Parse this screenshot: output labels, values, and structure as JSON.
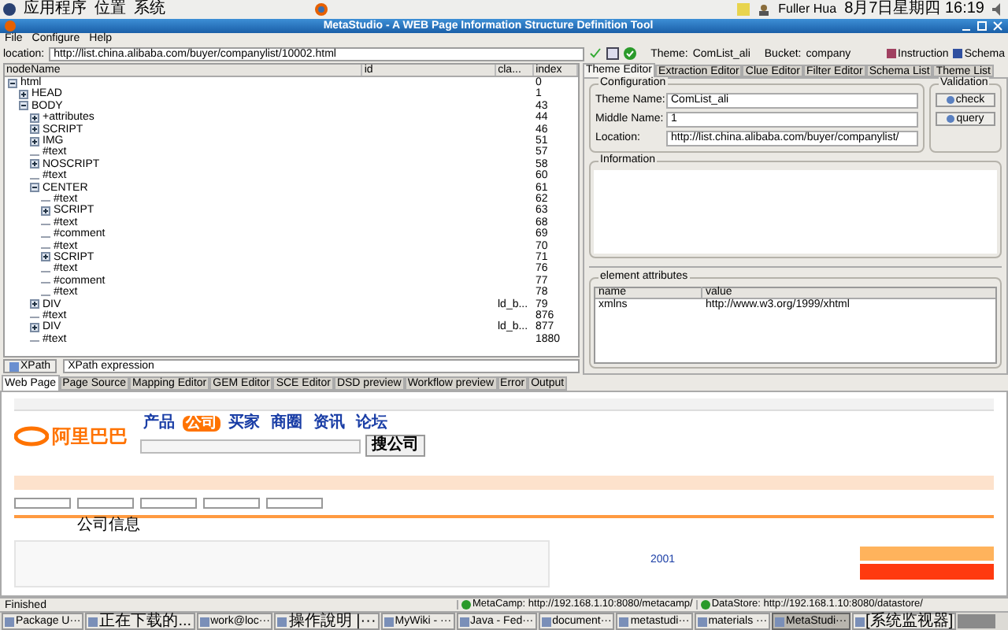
{
  "top_panel": {
    "menus": [
      "应用程序",
      "位置",
      "系统"
    ],
    "user": "Fuller Hua",
    "clock": "8月7日星期四 16:19"
  },
  "window": {
    "title": "MetaStudio - A WEB Page Information Structure Definition Tool"
  },
  "menu_bar": [
    "File",
    "Configure",
    "Help"
  ],
  "toolbar": {
    "location_label": "location:",
    "location": "http://list.china.alibaba.com/buyer/companylist/10002.html",
    "theme_label": "Theme:",
    "theme": "ComList_ali",
    "bucket_label": "Bucket:",
    "bucket": "company",
    "buttons": [
      "Instruction",
      "Schema"
    ]
  },
  "tree": {
    "columns": [
      "nodeName",
      "id",
      "cla...",
      "index"
    ],
    "nodes": [
      {
        "name": "html",
        "index": "0",
        "expanded": true,
        "children": [
          {
            "name": "HEAD",
            "index": "1",
            "expanded": false
          },
          {
            "name": "BODY",
            "index": "43",
            "expanded": true,
            "children": [
              {
                "name": "+attributes",
                "index": "44",
                "expanded": false
              },
              {
                "name": "SCRIPT",
                "index": "46",
                "expanded": false
              },
              {
                "name": "IMG",
                "index": "51",
                "expanded": false
              },
              {
                "name": "#text",
                "index": "57"
              },
              {
                "name": "NOSCRIPT",
                "index": "58",
                "expanded": false
              },
              {
                "name": "#text",
                "index": "60"
              },
              {
                "name": "CENTER",
                "index": "61",
                "expanded": true,
                "children": [
                  {
                    "name": "#text",
                    "index": "62"
                  },
                  {
                    "name": "SCRIPT",
                    "index": "63",
                    "expanded": false
                  },
                  {
                    "name": "#text",
                    "index": "68"
                  },
                  {
                    "name": "#comment",
                    "index": "69"
                  },
                  {
                    "name": "#text",
                    "index": "70"
                  },
                  {
                    "name": "SCRIPT",
                    "index": "71",
                    "expanded": false
                  },
                  {
                    "name": "#text",
                    "index": "76"
                  },
                  {
                    "name": "#comment",
                    "index": "77"
                  },
                  {
                    "name": "#text",
                    "index": "78"
                  }
                ]
              },
              {
                "name": "DIV",
                "cls": "ld_b...",
                "index": "79",
                "expanded": false
              },
              {
                "name": "#text",
                "index": "876"
              },
              {
                "name": "DIV",
                "cls": "ld_b...",
                "index": "877",
                "expanded": false
              },
              {
                "name": "#text",
                "index": "1880"
              }
            ]
          }
        ]
      }
    ]
  },
  "xpath": {
    "button": "XPath",
    "value": "XPath expression"
  },
  "editor_tabs": [
    {
      "label": "Theme Editor",
      "selected": true
    },
    {
      "label": "Extraction Editor",
      "selected": false
    },
    {
      "label": "Clue Editor",
      "selected": false
    },
    {
      "label": "Filter Editor",
      "selected": false
    },
    {
      "label": "Schema List",
      "selected": false
    },
    {
      "label": "Theme List",
      "selected": false
    }
  ],
  "configuration": {
    "title": "Configuration",
    "fields": [
      {
        "label": "Theme Name:",
        "value": "ComList_ali"
      },
      {
        "label": "Middle Name:",
        "value": "1"
      },
      {
        "label": "Location:",
        "value": "http://list.china.alibaba.com/buyer/companylist/"
      }
    ]
  },
  "validation": {
    "title": "Validation",
    "buttons": [
      "check",
      "query"
    ]
  },
  "information": {
    "title": "Information"
  },
  "element_attributes": {
    "title": "element attributes",
    "columns": [
      "name",
      "value"
    ],
    "rows": [
      [
        "xmlns",
        "http://www.w3.org/1999/xhtml"
      ]
    ]
  },
  "bottom_tabs": [
    {
      "label": "Web Page",
      "selected": true
    },
    {
      "label": "Page Source",
      "selected": false
    },
    {
      "label": "Mapping Editor",
      "selected": false
    },
    {
      "label": "GEM Editor",
      "selected": false
    },
    {
      "label": "SCE Editor",
      "selected": false
    },
    {
      "label": "DSD preview",
      "selected": false
    },
    {
      "label": "Workflow preview",
      "selected": false
    },
    {
      "label": "Error",
      "selected": false
    },
    {
      "label": "Output",
      "selected": false
    }
  ],
  "web_page": {
    "logo": "阿里巴巴",
    "nav": [
      {
        "label": "产品",
        "selected": false
      },
      {
        "label": "公司",
        "selected": true
      },
      {
        "label": "买家",
        "selected": false
      },
      {
        "label": "商圈",
        "selected": false
      },
      {
        "label": "资讯",
        "selected": false
      },
      {
        "label": "论坛",
        "selected": false
      }
    ],
    "search_button": "搜公司",
    "header": "公司信息",
    "year": "2001"
  },
  "status_bar": {
    "message": "Finished",
    "servers": [
      "MetaCamp: http://192.168.1.10:8080/metacamp/",
      "DataStore: http://192.168.1.10:8080/datastore/"
    ]
  },
  "taskbar": [
    {
      "label": "Package U···",
      "selected": false
    },
    {
      "label": "正在下载的...",
      "selected": false
    },
    {
      "label": "work@loc···",
      "selected": false
    },
    {
      "label": "操作說明 |···",
      "selected": false
    },
    {
      "label": "MyWiki - ···",
      "selected": false
    },
    {
      "label": "Java - Fed···",
      "selected": false
    },
    {
      "label": "document···",
      "selected": false
    },
    {
      "label": "metastudi···",
      "selected": false
    },
    {
      "label": "materials ···",
      "selected": false
    },
    {
      "label": "MetaStudi···",
      "selected": true
    },
    {
      "label": "[系统监视器]",
      "selected": false
    }
  ]
}
